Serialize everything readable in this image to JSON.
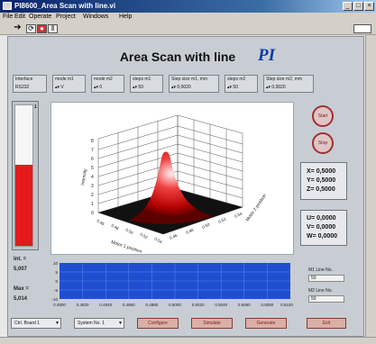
{
  "window": {
    "title": "PI8600_Area Scan with line.vi"
  },
  "menu": [
    "File",
    "Edit",
    "Operate",
    "Project",
    "Windows",
    "Help"
  ],
  "header": {
    "title": "Area Scan with line",
    "logo": "PI"
  },
  "interface": {
    "label": "Interface",
    "value": "RS232"
  },
  "params": [
    {
      "label": "mode m1",
      "value": "V"
    },
    {
      "label": "mode m2",
      "value": "0"
    },
    {
      "label": "steps m1",
      "value": "50"
    },
    {
      "label": "Step size m1, mm",
      "value": "0,0020"
    },
    {
      "label": "steps m2",
      "value": "50"
    },
    {
      "label": "Step size m2, mm",
      "value": "0,0020"
    }
  ],
  "round_buttons": [
    "Start",
    "Stop"
  ],
  "readout_xyz": {
    "x": "X= 0,5000",
    "y": "Y= 0,5000",
    "z": "Z= 0,5000"
  },
  "readout_uvw": {
    "u": "U= 0,0000",
    "v": "V= 0,0000",
    "w": "W= 0,0000"
  },
  "gauge": {
    "top_label": "1",
    "level": 0.58,
    "color": "#e51a1a"
  },
  "intensity": {
    "int_label": "Int. =",
    "int_value": "5,007",
    "max_label": "Max =",
    "max_value": "5,014"
  },
  "plot3d": {
    "zlabel": "Intensity",
    "xlabel": "Motor 1 position",
    "ylabel": "Motor 2 position",
    "z_ticks": [
      "0",
      "1",
      "2",
      "3",
      "4",
      "5",
      "6",
      "7",
      "8"
    ],
    "x_ticks": [
      "0.46",
      "0.48",
      "0.50",
      "0.52",
      "0.54"
    ],
    "y_ticks": [
      "0.46",
      "0.48",
      "0.50",
      "0.52",
      "0.54"
    ]
  },
  "line_plot": {
    "y_ticks": [
      "10",
      "5",
      "0",
      "-5",
      "-10"
    ],
    "x_ticks": [
      "0.4800",
      "0.4820",
      "0.4840",
      "0.4860",
      "0.4880",
      "0.5000",
      "0.5020",
      "0.5040",
      "0.5060",
      "0.5080",
      "0.5100"
    ],
    "bg_color": "#1f4fd0"
  },
  "line_numbers": {
    "m1_label": "M1 Line No.",
    "m1_value": "50",
    "m2_label": "M2 Line No.",
    "m2_value": "50"
  },
  "bottom": {
    "dropdowns": [
      "Ctrl. Board 1",
      "System No. 1"
    ],
    "buttons": [
      "Configure",
      "Simulate",
      "Generate",
      "Exit"
    ]
  },
  "colors": {
    "accent": "#e51a1a",
    "brand": "#0b3aa8"
  }
}
